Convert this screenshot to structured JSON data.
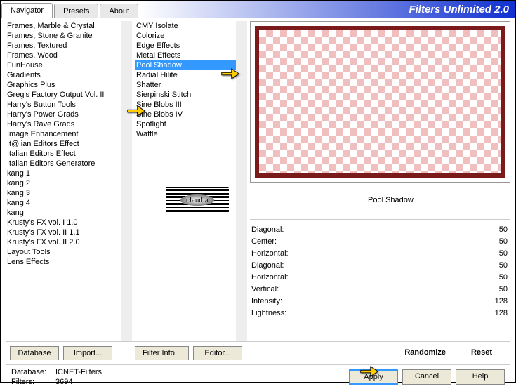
{
  "app_title": "Filters Unlimited 2.0",
  "tabs": {
    "navigator": "Navigator",
    "presets": "Presets",
    "about": "About"
  },
  "categories": [
    "Frames, Marble & Crystal",
    "Frames, Stone & Granite",
    "Frames, Textured",
    "Frames, Wood",
    "FunHouse",
    "Gradients",
    "Graphics Plus",
    "Greg's Factory Output Vol. II",
    "Harry's Button Tools",
    "Harry's Power Grads",
    "Harry's Rave Grads",
    "Image Enhancement",
    "It@lian Editors Effect",
    "Italian Editors Effect",
    "Italian Editors Generatore",
    "kang 1",
    "kang 2",
    "kang 3",
    "kang 4",
    "kang",
    "Krusty's FX vol. I 1.0",
    "Krusty's FX vol. II 1.1",
    "Krusty's FX vol. II 2.0",
    "Layout Tools",
    "Lens Effects"
  ],
  "selected_category_index": 7,
  "filters": [
    "CMY Isolate",
    "Colorize",
    "Edge Effects",
    "Metal Effects",
    "Pool Shadow",
    "Radial Hilite",
    "Shatter",
    "Sierpinski Stitch",
    "Sine Blobs III",
    "Sine Blobs IV",
    "Spotlight",
    "Waffle"
  ],
  "selected_filter_index": 4,
  "current_filter": "Pool Shadow",
  "watermark": "claudia",
  "params": [
    {
      "label": "Diagonal:",
      "value": "50"
    },
    {
      "label": "Center:",
      "value": "50"
    },
    {
      "label": "Horizontal:",
      "value": "50"
    },
    {
      "label": "Diagonal:",
      "value": "50"
    },
    {
      "label": "Horizontal:",
      "value": "50"
    },
    {
      "label": "Vertical:",
      "value": "50"
    },
    {
      "label": "Intensity:",
      "value": "128"
    },
    {
      "label": "Lightness:",
      "value": "128"
    }
  ],
  "buttons": {
    "database": "Database",
    "import": "Import...",
    "filter_info": "Filter Info...",
    "editor": "Editor...",
    "randomize": "Randomize",
    "reset": "Reset",
    "apply": "Apply",
    "cancel": "Cancel",
    "help": "Help"
  },
  "info": {
    "db_label": "Database:",
    "db_value": "ICNET-Filters",
    "filters_label": "Filters:",
    "filters_value": "3694"
  }
}
